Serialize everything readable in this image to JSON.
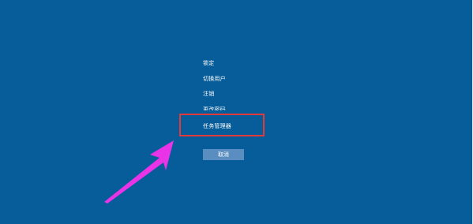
{
  "menu": {
    "items": [
      {
        "label": "锁定"
      },
      {
        "label": "切换用户"
      },
      {
        "label": "注销"
      },
      {
        "label": "更改密码"
      },
      {
        "label": "任务管理器"
      }
    ]
  },
  "cancel_label": "取消",
  "colors": {
    "background": "#065d99",
    "highlight": "#e23a3a",
    "arrow": "#e933e6",
    "button": "#5a8ec0"
  }
}
